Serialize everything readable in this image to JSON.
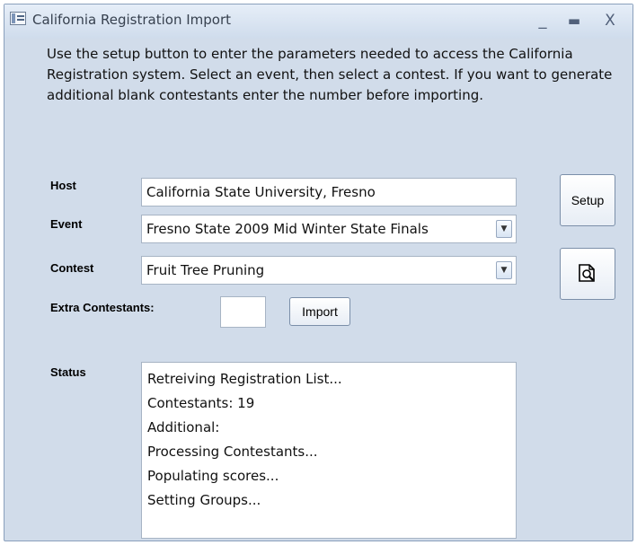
{
  "window": {
    "title": "California Registration Import",
    "controls": {
      "minimize": "_",
      "maximize": "▬",
      "close": "X"
    }
  },
  "intro_text": "Use the setup button to enter the parameters needed to access the California Registration system.  Select an event, then select a contest.  If you want to generate additional blank contestants enter the number before importing.",
  "form": {
    "host_label": "Host",
    "host_value": "California State University, Fresno",
    "event_label": "Event",
    "event_value": "Fresno State 2009 Mid Winter State Finals",
    "contest_label": "Contest",
    "contest_value": "Fruit Tree Pruning",
    "extra_label": "Extra Contestants:",
    "extra_value": "",
    "import_label": "Import",
    "setup_label": "Setup",
    "status_label": "Status"
  },
  "status_lines": [
    "Retreiving Registration List...",
    "Contestants: 19",
    "Additional:",
    "Processing Contestants...",
    "Populating scores...",
    "Setting Groups..."
  ],
  "icons": {
    "title": "form-icon",
    "preview": "print-preview-icon",
    "dropdown": "chevron-down-icon"
  }
}
